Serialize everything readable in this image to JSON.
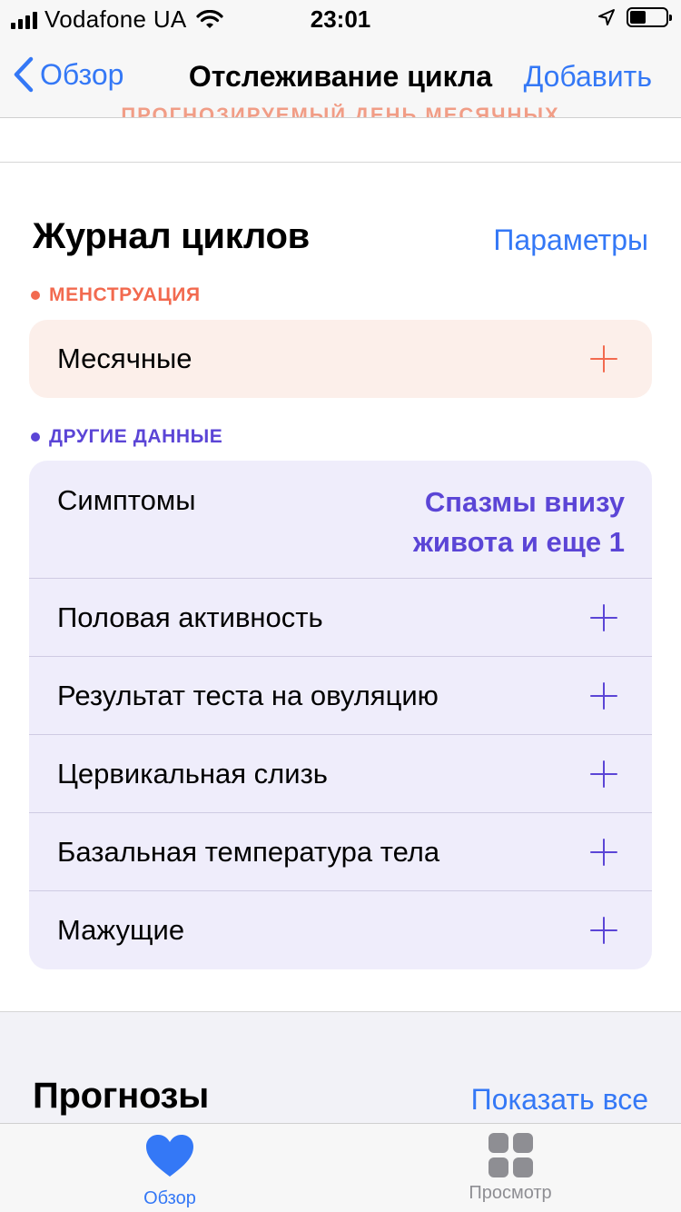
{
  "status_bar": {
    "carrier": "Vodafone UA",
    "time": "23:01"
  },
  "nav": {
    "back_label": "Обзор",
    "title": "Отслеживание цикла",
    "add_label": "Добавить",
    "scrolled_text": "ПРОГНОЗИРУЕМЫЙ ДЕНЬ МЕСЯЧНЫХ"
  },
  "cycle_log": {
    "title": "Журнал циклов",
    "options_label": "Параметры",
    "menstruation": {
      "category": "МЕНСТРУАЦИЯ",
      "row_label": "Месячные",
      "accent_color": "#f26a4f"
    },
    "other": {
      "category": "ДРУГИЕ ДАННЫЕ",
      "accent_color": "#5b45d6",
      "symptoms_label": "Симптомы",
      "symptoms_value_line1": "Спазмы внизу",
      "symptoms_value_line2": "живота и еще 1",
      "rows": [
        {
          "label": "Половая активность"
        },
        {
          "label": "Результат теста на овуляцию"
        },
        {
          "label": "Цервикальная слизь"
        },
        {
          "label": "Базальная температура тела"
        },
        {
          "label": "Мажущие"
        }
      ]
    }
  },
  "forecasts": {
    "title": "Прогнозы",
    "show_all_label": "Показать все"
  },
  "tab_bar": {
    "overview_label": "Обзор",
    "browse_label": "Просмотр",
    "active_color": "#3478f6",
    "inactive_color": "#8e8e93"
  }
}
